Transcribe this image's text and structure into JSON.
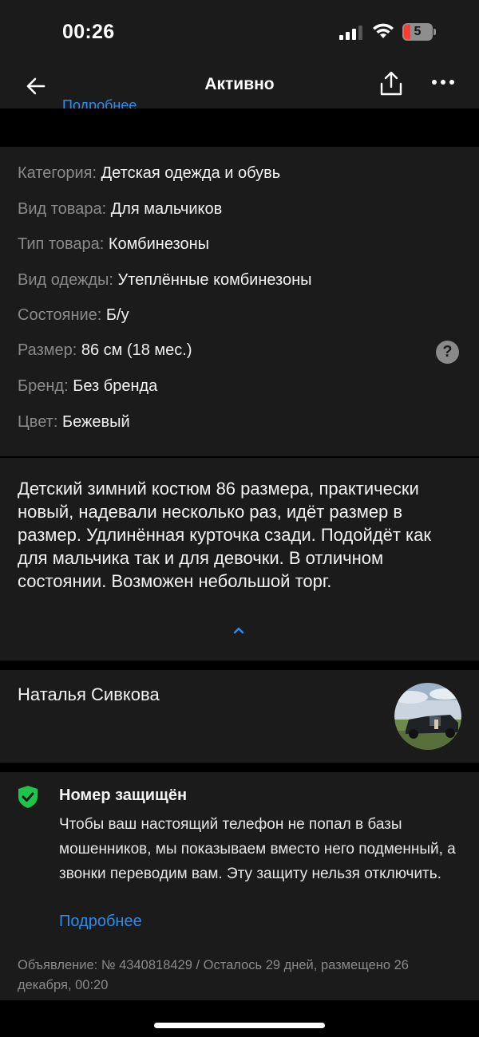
{
  "status_bar": {
    "time": "00:26",
    "battery_level": "5",
    "icons": [
      "signal-icon",
      "wifi-icon",
      "battery-icon"
    ]
  },
  "nav": {
    "title": "Активно",
    "hidden_link": "Подробнее",
    "icons": [
      "arrow-left-icon",
      "share-icon",
      "more-icon"
    ]
  },
  "params": [
    {
      "key": "Категория:",
      "value": "Детская одежда и обувь"
    },
    {
      "key": "Вид товара:",
      "value": "Для мальчиков"
    },
    {
      "key": "Тип товара:",
      "value": "Комбинезоны"
    },
    {
      "key": "Вид одежды:",
      "value": "Утеплённые комбинезоны"
    },
    {
      "key": "Состояние:",
      "value": "Б/у"
    },
    {
      "key": "Размер:",
      "value": "86 см (18 мес.)"
    },
    {
      "key": "Бренд:",
      "value": "Без бренда"
    },
    {
      "key": "Цвет:",
      "value": "Бежевый"
    }
  ],
  "help_label": "?",
  "description": "Детский зимний костюм 86 размера, практически новый, надевали несколько раз, идёт размер в размер. Удлинённая курточка сзади. Подойдёт как для мальчика так и для девочки. В отличном состоянии. Возможен небольшой торг.",
  "seller": {
    "name": "Наталья Сивкова"
  },
  "protection": {
    "title": "Номер защищён",
    "text": "Чтобы ваш настоящий телефон не попал в базы мошенников, мы показываем вместо него подменный, а звонки переводим вам. Эту защиту нельзя отключить.",
    "link": "Подробнее"
  },
  "footer": {
    "text": "Объявление: № 4340818429 / Осталось 29 дней, размещено 26 декабря, 00:20"
  },
  "colors": {
    "background": "#1b1b1b",
    "separator": "#000000",
    "muted_text": "#8a8a8a",
    "link": "#2d8cf0",
    "shield_green": "#1fc44a"
  }
}
